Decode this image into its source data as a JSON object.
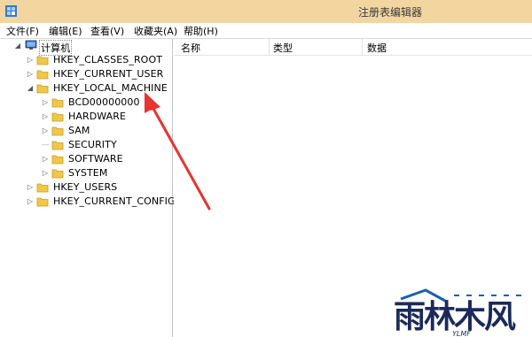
{
  "window": {
    "title": "注册表编辑器"
  },
  "menu": [
    "文件(F)",
    "编辑(E)",
    "查看(V)",
    "收藏夹(A)",
    "帮助(H)"
  ],
  "tree": {
    "root": "计算机",
    "hives": [
      "HKEY_CLASSES_ROOT",
      "HKEY_CURRENT_USER",
      "HKEY_LOCAL_MACHINE",
      "HKEY_USERS",
      "HKEY_CURRENT_CONFIG"
    ],
    "local_machine_children": [
      "BCD00000000",
      "HARDWARE",
      "SAM",
      "SECURITY",
      "SOFTWARE",
      "SYSTEM"
    ]
  },
  "list": {
    "columns": [
      "名称",
      "类型",
      "数据"
    ]
  },
  "colors": {
    "titlebar": "#f3d5a0",
    "folder": "#f0c848",
    "arrow": "#e8332f",
    "watermark_blue": "#1a2a5a"
  },
  "watermark": {
    "text": "雨林木风",
    "subtext": "YLMF"
  }
}
